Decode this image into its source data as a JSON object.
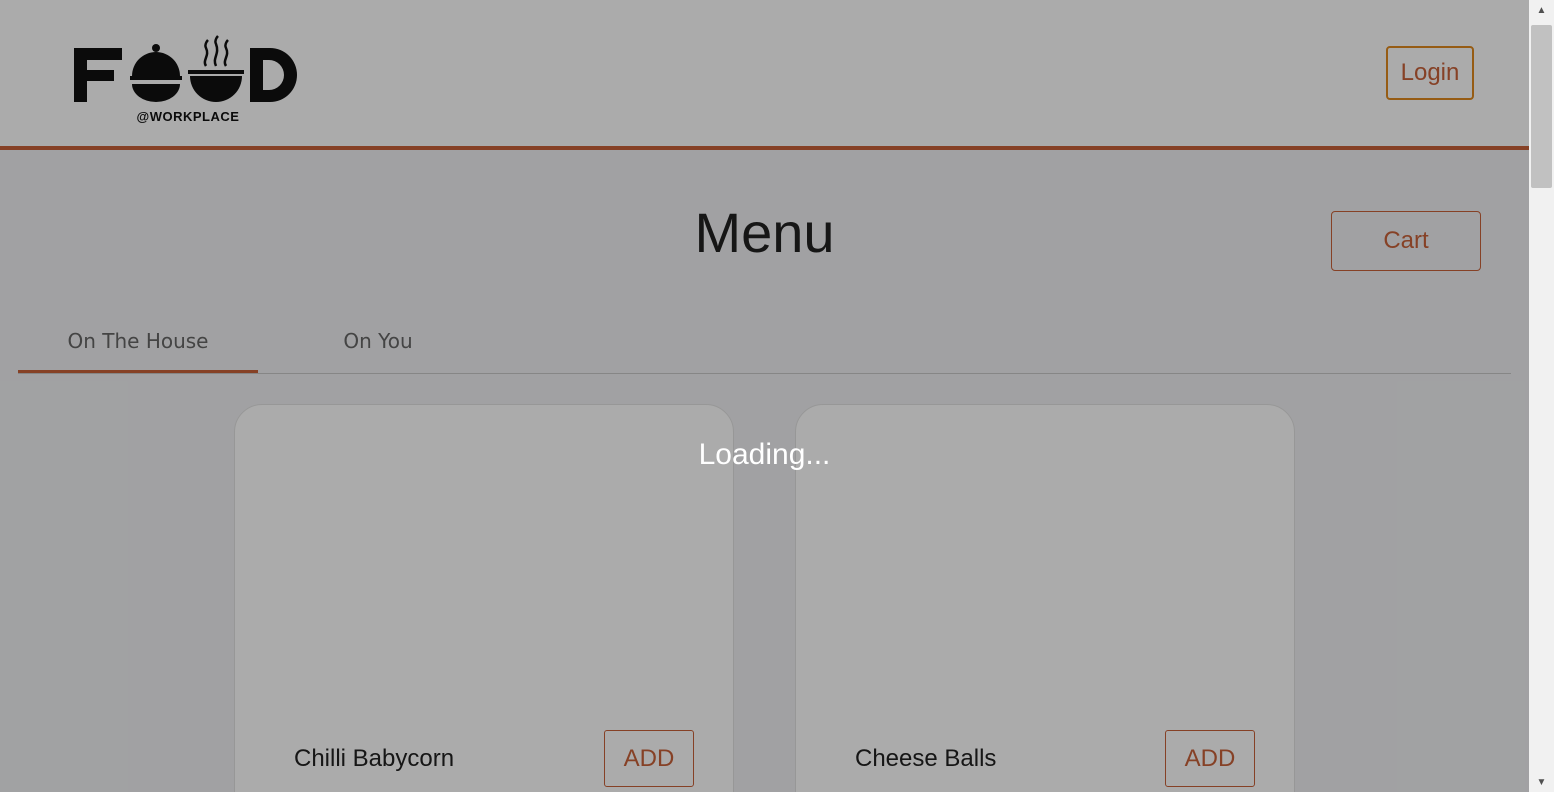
{
  "header": {
    "logo_text": "FOOD",
    "logo_subtext": "@WORKPLACE",
    "login_label": "Login"
  },
  "main": {
    "title": "Menu",
    "cart_label": "Cart",
    "tabs": [
      {
        "label": "On The House",
        "active": true
      },
      {
        "label": "On You",
        "active": false
      }
    ],
    "items": [
      {
        "name": "Chilli Babycorn",
        "add_label": "ADD"
      },
      {
        "name": "Cheese Balls",
        "add_label": "ADD"
      }
    ]
  },
  "overlay": {
    "loading_text": "Loading..."
  },
  "colors": {
    "accent": "#c8623a",
    "login_border": "#e08a1e",
    "content_bg": "#f0f1f3"
  }
}
